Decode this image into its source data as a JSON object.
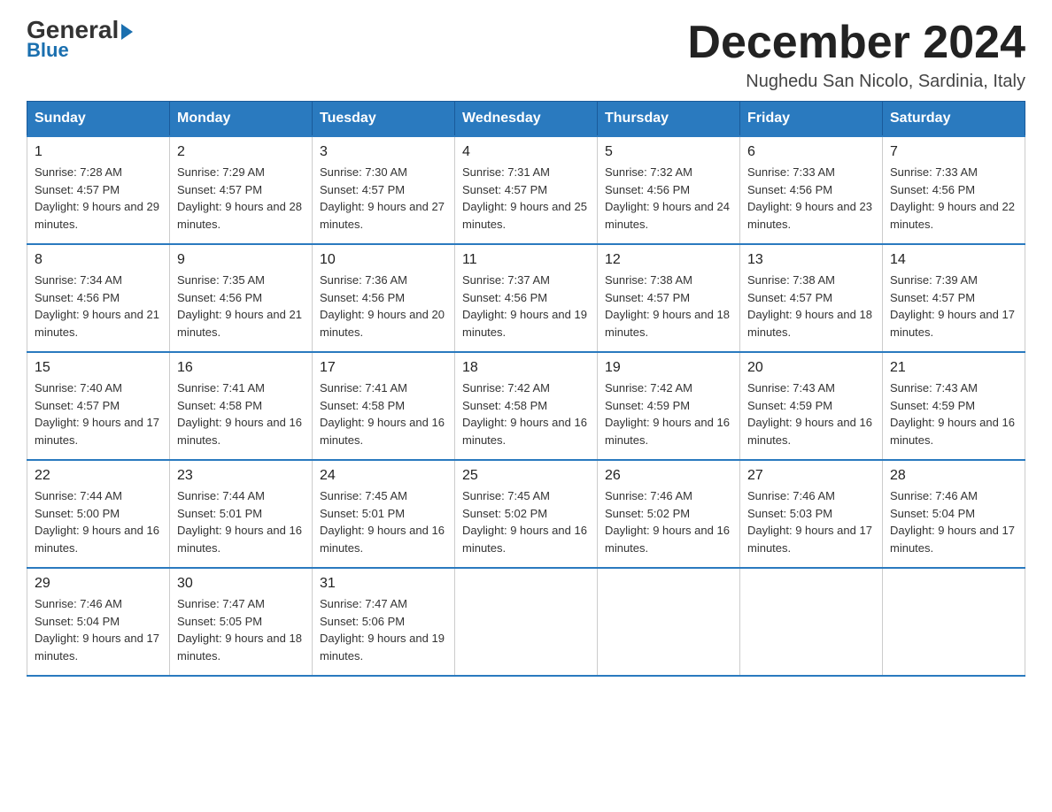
{
  "logo": {
    "line1_black": "General",
    "line1_blue": "Blue",
    "line2": "Blue"
  },
  "header": {
    "title": "December 2024",
    "subtitle": "Nughedu San Nicolo, Sardinia, Italy"
  },
  "days_of_week": [
    "Sunday",
    "Monday",
    "Tuesday",
    "Wednesday",
    "Thursday",
    "Friday",
    "Saturday"
  ],
  "weeks": [
    [
      {
        "num": "1",
        "sunrise": "7:28 AM",
        "sunset": "4:57 PM",
        "daylight": "9 hours and 29 minutes."
      },
      {
        "num": "2",
        "sunrise": "7:29 AM",
        "sunset": "4:57 PM",
        "daylight": "9 hours and 28 minutes."
      },
      {
        "num": "3",
        "sunrise": "7:30 AM",
        "sunset": "4:57 PM",
        "daylight": "9 hours and 27 minutes."
      },
      {
        "num": "4",
        "sunrise": "7:31 AM",
        "sunset": "4:57 PM",
        "daylight": "9 hours and 25 minutes."
      },
      {
        "num": "5",
        "sunrise": "7:32 AM",
        "sunset": "4:56 PM",
        "daylight": "9 hours and 24 minutes."
      },
      {
        "num": "6",
        "sunrise": "7:33 AM",
        "sunset": "4:56 PM",
        "daylight": "9 hours and 23 minutes."
      },
      {
        "num": "7",
        "sunrise": "7:33 AM",
        "sunset": "4:56 PM",
        "daylight": "9 hours and 22 minutes."
      }
    ],
    [
      {
        "num": "8",
        "sunrise": "7:34 AM",
        "sunset": "4:56 PM",
        "daylight": "9 hours and 21 minutes."
      },
      {
        "num": "9",
        "sunrise": "7:35 AM",
        "sunset": "4:56 PM",
        "daylight": "9 hours and 21 minutes."
      },
      {
        "num": "10",
        "sunrise": "7:36 AM",
        "sunset": "4:56 PM",
        "daylight": "9 hours and 20 minutes."
      },
      {
        "num": "11",
        "sunrise": "7:37 AM",
        "sunset": "4:56 PM",
        "daylight": "9 hours and 19 minutes."
      },
      {
        "num": "12",
        "sunrise": "7:38 AM",
        "sunset": "4:57 PM",
        "daylight": "9 hours and 18 minutes."
      },
      {
        "num": "13",
        "sunrise": "7:38 AM",
        "sunset": "4:57 PM",
        "daylight": "9 hours and 18 minutes."
      },
      {
        "num": "14",
        "sunrise": "7:39 AM",
        "sunset": "4:57 PM",
        "daylight": "9 hours and 17 minutes."
      }
    ],
    [
      {
        "num": "15",
        "sunrise": "7:40 AM",
        "sunset": "4:57 PM",
        "daylight": "9 hours and 17 minutes."
      },
      {
        "num": "16",
        "sunrise": "7:41 AM",
        "sunset": "4:58 PM",
        "daylight": "9 hours and 16 minutes."
      },
      {
        "num": "17",
        "sunrise": "7:41 AM",
        "sunset": "4:58 PM",
        "daylight": "9 hours and 16 minutes."
      },
      {
        "num": "18",
        "sunrise": "7:42 AM",
        "sunset": "4:58 PM",
        "daylight": "9 hours and 16 minutes."
      },
      {
        "num": "19",
        "sunrise": "7:42 AM",
        "sunset": "4:59 PM",
        "daylight": "9 hours and 16 minutes."
      },
      {
        "num": "20",
        "sunrise": "7:43 AM",
        "sunset": "4:59 PM",
        "daylight": "9 hours and 16 minutes."
      },
      {
        "num": "21",
        "sunrise": "7:43 AM",
        "sunset": "4:59 PM",
        "daylight": "9 hours and 16 minutes."
      }
    ],
    [
      {
        "num": "22",
        "sunrise": "7:44 AM",
        "sunset": "5:00 PM",
        "daylight": "9 hours and 16 minutes."
      },
      {
        "num": "23",
        "sunrise": "7:44 AM",
        "sunset": "5:01 PM",
        "daylight": "9 hours and 16 minutes."
      },
      {
        "num": "24",
        "sunrise": "7:45 AM",
        "sunset": "5:01 PM",
        "daylight": "9 hours and 16 minutes."
      },
      {
        "num": "25",
        "sunrise": "7:45 AM",
        "sunset": "5:02 PM",
        "daylight": "9 hours and 16 minutes."
      },
      {
        "num": "26",
        "sunrise": "7:46 AM",
        "sunset": "5:02 PM",
        "daylight": "9 hours and 16 minutes."
      },
      {
        "num": "27",
        "sunrise": "7:46 AM",
        "sunset": "5:03 PM",
        "daylight": "9 hours and 17 minutes."
      },
      {
        "num": "28",
        "sunrise": "7:46 AM",
        "sunset": "5:04 PM",
        "daylight": "9 hours and 17 minutes."
      }
    ],
    [
      {
        "num": "29",
        "sunrise": "7:46 AM",
        "sunset": "5:04 PM",
        "daylight": "9 hours and 17 minutes."
      },
      {
        "num": "30",
        "sunrise": "7:47 AM",
        "sunset": "5:05 PM",
        "daylight": "9 hours and 18 minutes."
      },
      {
        "num": "31",
        "sunrise": "7:47 AM",
        "sunset": "5:06 PM",
        "daylight": "9 hours and 19 minutes."
      },
      null,
      null,
      null,
      null
    ]
  ]
}
